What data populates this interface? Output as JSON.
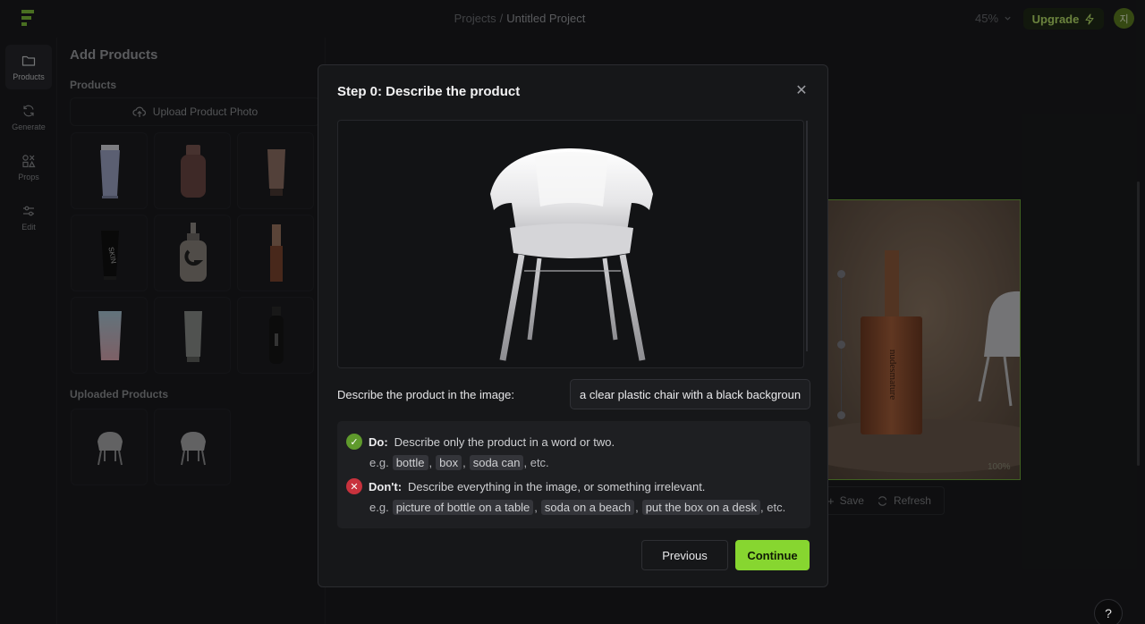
{
  "app": {
    "breadcrumb": {
      "root": "Projects",
      "separator": "/",
      "current": "Untitled Project"
    },
    "zoom_level": "45%",
    "upgrade_label": "Upgrade",
    "avatar_initial": "지"
  },
  "sidebar": {
    "items": [
      {
        "label": "Products",
        "icon": "folder-icon",
        "active": true
      },
      {
        "label": "Generate",
        "icon": "refresh-icon",
        "active": false
      },
      {
        "label": "Props",
        "icon": "props-icon",
        "active": false
      },
      {
        "label": "Edit",
        "icon": "sliders-icon",
        "active": false
      }
    ]
  },
  "panel": {
    "title": "Add Products",
    "products_label": "Products",
    "upload_label": "Upload Product Photo",
    "uploaded_label": "Uploaded Products"
  },
  "canvas": {
    "zoom_badge": "100%",
    "save_label": "Save",
    "refresh_label": "Refresh",
    "accent": "#6ea73a"
  },
  "modal": {
    "title": "Step 0: Describe the product",
    "describe_label": "Describe the product in the image:",
    "describe_value": "a clear plastic chair with a black background",
    "do": {
      "heading": "Do:",
      "text": "Describe only the product in a word or two.",
      "eg": "e.g.",
      "examples": [
        "bottle",
        "box",
        "soda can"
      ],
      "suffix": ", etc."
    },
    "dont": {
      "heading": "Don't:",
      "text": "Describe everything in the image, or something irrelevant.",
      "eg": "e.g.",
      "examples": [
        "picture of bottle on a table",
        "soda on a beach",
        "put the box on a desk"
      ],
      "suffix": ", etc."
    },
    "previous_label": "Previous",
    "continue_label": "Continue",
    "continue_color": "#87d630"
  },
  "help_label": "?"
}
